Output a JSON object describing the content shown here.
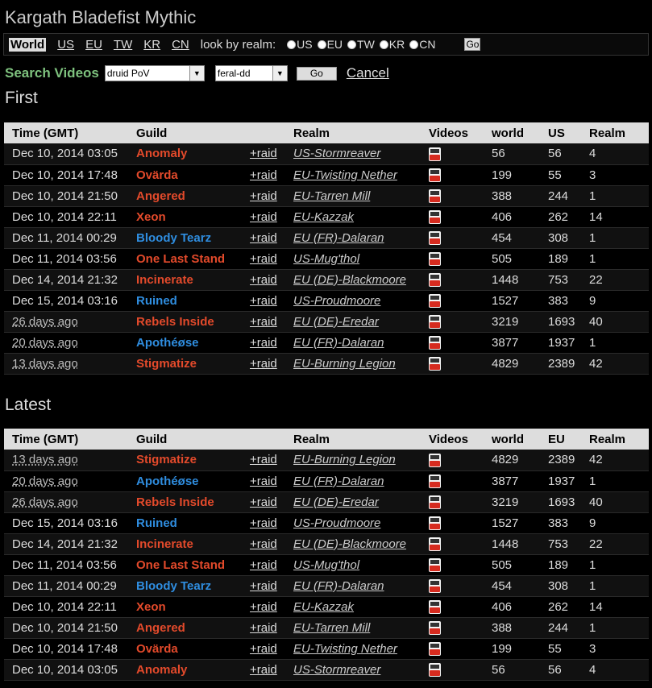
{
  "page_title": "Kargath Bladefist Mythic",
  "nav": {
    "regions": [
      "World",
      "US",
      "EU",
      "TW",
      "KR",
      "CN"
    ],
    "look_label": "look by realm:",
    "realm_radios": [
      "US",
      "EU",
      "TW",
      "KR",
      "CN"
    ],
    "go_label": "Go"
  },
  "search": {
    "label": "Search Videos",
    "select1": "druid PoV",
    "select2": "feral-dd",
    "go_label": "Go",
    "cancel_label": "Cancel"
  },
  "first": {
    "title": "First",
    "headers": [
      "Time (GMT)",
      "Guild",
      "",
      "Realm",
      "Videos",
      "world",
      "US",
      "Realm"
    ],
    "raid_label": "+raid",
    "rows": [
      {
        "time": "Dec 10, 2014 03:05",
        "ago": false,
        "guild": "Anomaly",
        "color": "red",
        "realm": "US-Stormreaver",
        "world": "56",
        "region": "56",
        "realm_rank": "4"
      },
      {
        "time": "Dec 10, 2014 17:48",
        "ago": false,
        "guild": "Ovärda",
        "color": "red",
        "realm": "EU-Twisting Nether",
        "world": "199",
        "region": "55",
        "realm_rank": "3"
      },
      {
        "time": "Dec 10, 2014 21:50",
        "ago": false,
        "guild": "Angered",
        "color": "red",
        "realm": "EU-Tarren Mill",
        "world": "388",
        "region": "244",
        "realm_rank": "1"
      },
      {
        "time": "Dec 10, 2014 22:11",
        "ago": false,
        "guild": "Xeon",
        "color": "red",
        "realm": "EU-Kazzak",
        "world": "406",
        "region": "262",
        "realm_rank": "14"
      },
      {
        "time": "Dec 11, 2014 00:29",
        "ago": false,
        "guild": "Bloody Tearz",
        "color": "blue",
        "realm": "EU (FR)-Dalaran",
        "world": "454",
        "region": "308",
        "realm_rank": "1"
      },
      {
        "time": "Dec 11, 2014 03:56",
        "ago": false,
        "guild": "One Last Stand",
        "color": "red",
        "realm": "US-Mug'thol",
        "world": "505",
        "region": "189",
        "realm_rank": "1"
      },
      {
        "time": "Dec 14, 2014 21:32",
        "ago": false,
        "guild": "Incinerate",
        "color": "red",
        "realm": "EU (DE)-Blackmoore",
        "world": "1448",
        "region": "753",
        "realm_rank": "22"
      },
      {
        "time": "Dec 15, 2014 03:16",
        "ago": false,
        "guild": "Ruined",
        "color": "blue",
        "realm": "US-Proudmoore",
        "world": "1527",
        "region": "383",
        "realm_rank": "9"
      },
      {
        "time": "26 days ago",
        "ago": true,
        "guild": "Rebels Inside",
        "color": "red",
        "realm": "EU (DE)-Eredar",
        "world": "3219",
        "region": "1693",
        "realm_rank": "40"
      },
      {
        "time": "20 days ago",
        "ago": true,
        "guild": "Apothéøse",
        "color": "blue",
        "realm": "EU (FR)-Dalaran",
        "world": "3877",
        "region": "1937",
        "realm_rank": "1"
      },
      {
        "time": "13 days ago",
        "ago": true,
        "guild": "Stigmatize",
        "color": "red",
        "realm": "EU-Burning Legion",
        "world": "4829",
        "region": "2389",
        "realm_rank": "42"
      }
    ]
  },
  "latest": {
    "title": "Latest",
    "headers": [
      "Time (GMT)",
      "Guild",
      "",
      "Realm",
      "Videos",
      "world",
      "EU",
      "Realm"
    ],
    "raid_label": "+raid",
    "rows": [
      {
        "time": "13 days ago",
        "ago": true,
        "guild": "Stigmatize",
        "color": "red",
        "realm": "EU-Burning Legion",
        "world": "4829",
        "region": "2389",
        "realm_rank": "42"
      },
      {
        "time": "20 days ago",
        "ago": true,
        "guild": "Apothéøse",
        "color": "blue",
        "realm": "EU (FR)-Dalaran",
        "world": "3877",
        "region": "1937",
        "realm_rank": "1"
      },
      {
        "time": "26 days ago",
        "ago": true,
        "guild": "Rebels Inside",
        "color": "red",
        "realm": "EU (DE)-Eredar",
        "world": "3219",
        "region": "1693",
        "realm_rank": "40"
      },
      {
        "time": "Dec 15, 2014 03:16",
        "ago": false,
        "guild": "Ruined",
        "color": "blue",
        "realm": "US-Proudmoore",
        "world": "1527",
        "region": "383",
        "realm_rank": "9"
      },
      {
        "time": "Dec 14, 2014 21:32",
        "ago": false,
        "guild": "Incinerate",
        "color": "red",
        "realm": "EU (DE)-Blackmoore",
        "world": "1448",
        "region": "753",
        "realm_rank": "22"
      },
      {
        "time": "Dec 11, 2014 03:56",
        "ago": false,
        "guild": "One Last Stand",
        "color": "red",
        "realm": "US-Mug'thol",
        "world": "505",
        "region": "189",
        "realm_rank": "1"
      },
      {
        "time": "Dec 11, 2014 00:29",
        "ago": false,
        "guild": "Bloody Tearz",
        "color": "blue",
        "realm": "EU (FR)-Dalaran",
        "world": "454",
        "region": "308",
        "realm_rank": "1"
      },
      {
        "time": "Dec 10, 2014 22:11",
        "ago": false,
        "guild": "Xeon",
        "color": "red",
        "realm": "EU-Kazzak",
        "world": "406",
        "region": "262",
        "realm_rank": "14"
      },
      {
        "time": "Dec 10, 2014 21:50",
        "ago": false,
        "guild": "Angered",
        "color": "red",
        "realm": "EU-Tarren Mill",
        "world": "388",
        "region": "244",
        "realm_rank": "1"
      },
      {
        "time": "Dec 10, 2014 17:48",
        "ago": false,
        "guild": "Ovärda",
        "color": "red",
        "realm": "EU-Twisting Nether",
        "world": "199",
        "region": "55",
        "realm_rank": "3"
      },
      {
        "time": "Dec 10, 2014 03:05",
        "ago": false,
        "guild": "Anomaly",
        "color": "red",
        "realm": "US-Stormreaver",
        "world": "56",
        "region": "56",
        "realm_rank": "4"
      }
    ]
  },
  "colors": {
    "red": "#e34a2b",
    "blue": "#2f8ddf",
    "search_label": "#7ec27e",
    "header_bg": "#dddddd"
  },
  "icons": {
    "video": "youtube-icon"
  }
}
